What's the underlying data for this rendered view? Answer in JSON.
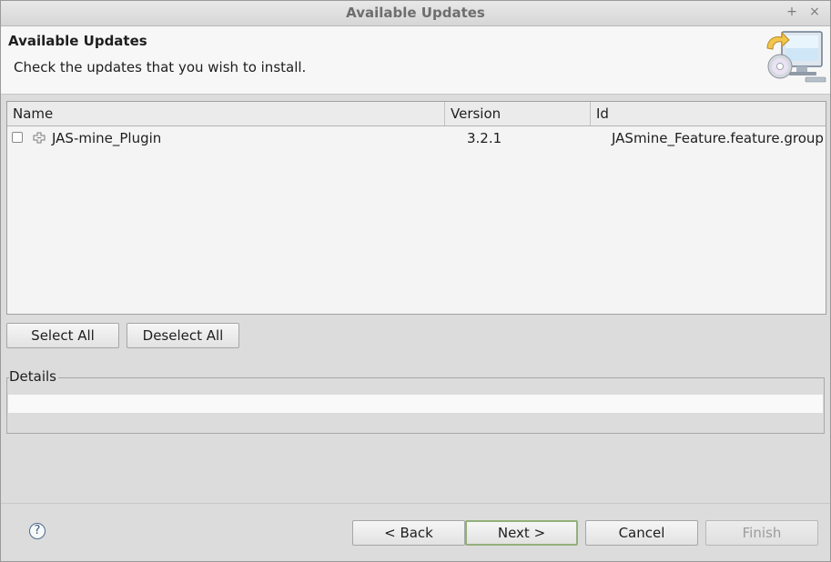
{
  "window": {
    "title": "Available Updates"
  },
  "header": {
    "title": "Available Updates",
    "description": "Check the updates that you wish to install."
  },
  "table": {
    "columns": [
      "Name",
      "Version",
      "Id"
    ],
    "rows": [
      {
        "checked": false,
        "name": "JAS-mine_Plugin",
        "version": "3.2.1",
        "id": "JASmine_Feature.feature.group"
      }
    ]
  },
  "selection": {
    "select_all": "Select All",
    "deselect_all": "Deselect All"
  },
  "details": {
    "label": "Details"
  },
  "footer": {
    "help": "?",
    "back": "< Back",
    "next": "Next >",
    "cancel": "Cancel",
    "finish": "Finish"
  },
  "titlebar_buttons": {
    "maximize": "+",
    "close": "×"
  }
}
